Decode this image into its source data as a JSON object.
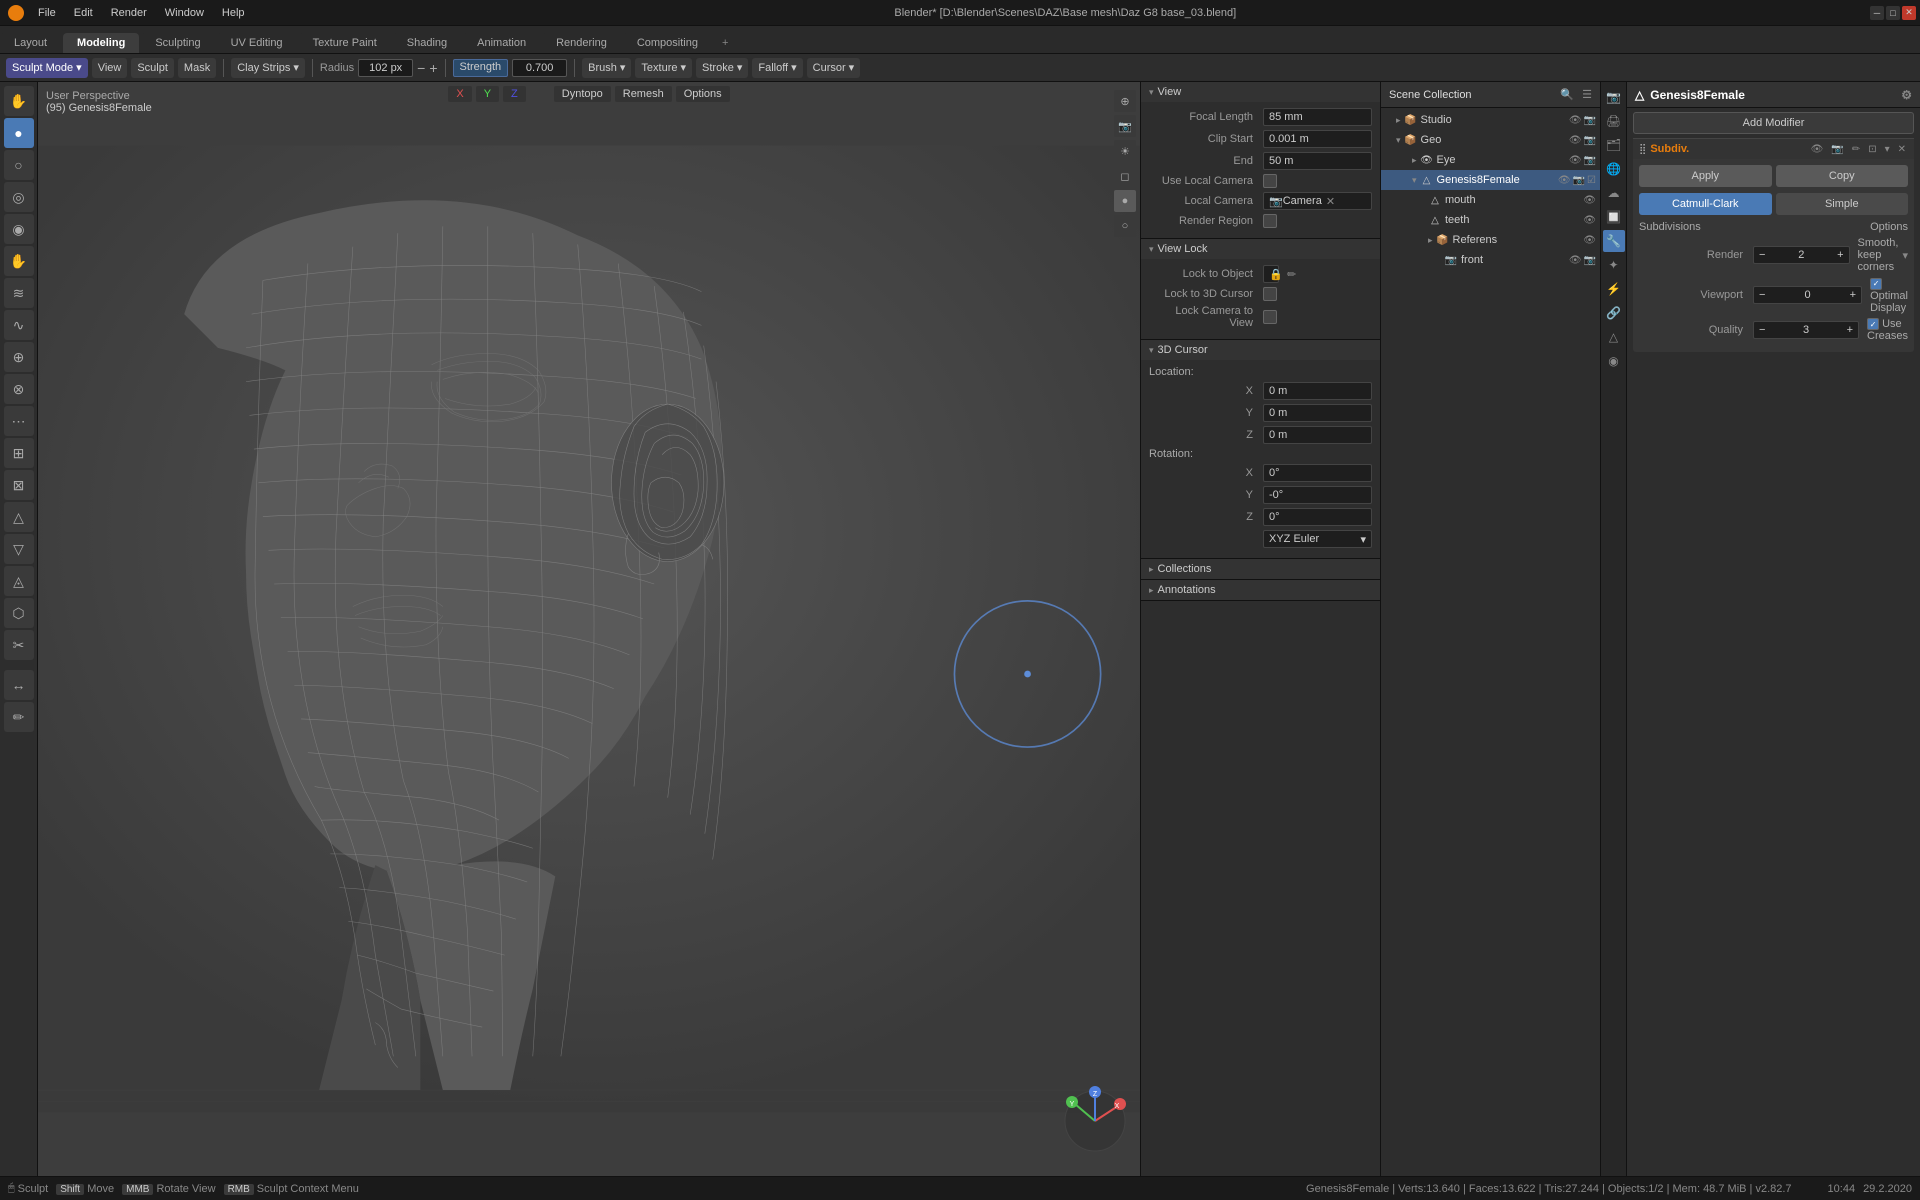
{
  "title_bar": {
    "title": "Blender* [D:\\Blender\\Scenes\\DAZ\\Base mesh\\Daz G8 base_03.blend]",
    "logo_color": "#e87d0d"
  },
  "menu": {
    "items": [
      "File",
      "Edit",
      "Render",
      "Window",
      "Help"
    ],
    "workspace_tabs": [
      "Layout",
      "Modeling",
      "Sculpting",
      "UV Editing",
      "Texture Paint",
      "Shading",
      "Animation",
      "Rendering",
      "Compositing"
    ],
    "active_tab": "Modeling"
  },
  "toolbar": {
    "mode_label": "Sculpt Mode",
    "view_label": "View",
    "sculpt_label": "Sculpt",
    "mask_label": "Mask",
    "brush_name": "Clay Strips",
    "radius_label": "Radius",
    "radius_value": "102 px",
    "strength_label": "Strength",
    "strength_value": "0.700",
    "brush_label": "Brush",
    "texture_label": "Texture",
    "stroke_label": "Stroke",
    "falloff_label": "Falloff",
    "cursor_label": "Cursor"
  },
  "viewport": {
    "view_label": "User Perspective",
    "object_name": "(95) Genesis8Female",
    "dyntopo_label": "Dyntopo",
    "remesh_label": "Remesh",
    "options_label": "Options"
  },
  "view_panel": {
    "title": "View",
    "focal_length_label": "Focal Length",
    "focal_length_value": "85 mm",
    "clip_start_label": "Clip Start",
    "clip_start_value": "0.001 m",
    "end_label": "End",
    "end_value": "50 m",
    "use_local_camera_label": "Use Local Camera",
    "local_camera_label": "Local Camera",
    "camera_label": "Camera",
    "render_region_label": "Render Region"
  },
  "view_lock_panel": {
    "title": "View Lock",
    "lock_to_object_label": "Lock to Object",
    "lock_to_3d_cursor_label": "Lock to 3D Cursor",
    "lock_camera_to_view_label": "Lock Camera to View"
  },
  "cursor_panel": {
    "title": "3D Cursor",
    "location_label": "Location:",
    "x_label": "X",
    "x_value": "0 m",
    "y_label": "Y",
    "y_value": "0 m",
    "z_label": "Z",
    "z_value": "0 m",
    "rotation_label": "Rotation:",
    "rx_value": "0°",
    "ry_value": "-0°",
    "rz_value": "0°",
    "xyz_euler_label": "XYZ Euler"
  },
  "collections_panel": {
    "title": "Collections"
  },
  "annotations_panel": {
    "title": "Annotations"
  },
  "outliner": {
    "title": "Scene Collection",
    "items": [
      {
        "name": "Studio",
        "level": 1,
        "icon": "📦",
        "active": false
      },
      {
        "name": "Geo",
        "level": 1,
        "icon": "📦",
        "active": false
      },
      {
        "name": "Eye",
        "level": 2,
        "icon": "👁",
        "active": false
      },
      {
        "name": "Genesis8Female",
        "level": 2,
        "icon": "△",
        "active": true
      },
      {
        "name": "mouth",
        "level": 3,
        "icon": "△",
        "active": false
      },
      {
        "name": "teeth",
        "level": 3,
        "icon": "△",
        "active": false
      },
      {
        "name": "Referens",
        "level": 3,
        "icon": "📦",
        "active": false
      },
      {
        "name": "front",
        "level": 3,
        "icon": "📷",
        "active": false
      }
    ]
  },
  "properties": {
    "object_name": "Genesis8Female",
    "add_modifier_label": "Add Modifier",
    "modifier": {
      "name": "Subdiv.",
      "apply_label": "Apply",
      "copy_label": "Copy",
      "catmull_clark_label": "Catmull-Clark",
      "simple_label": "Simple",
      "subdivisions_label": "Subdivisions",
      "render_label": "Render",
      "render_value": "2",
      "viewport_label": "Viewport",
      "viewport_value": "0",
      "quality_label": "Quality",
      "quality_value": "3",
      "options_label": "Options",
      "smooth_keep_corners_label": "Smooth, keep corners",
      "optimal_display_label": "Optimal Display",
      "use_creases_label": "Use Creases"
    }
  },
  "status_bar": {
    "sculpt_label": "Sculpt",
    "move_label": "Move",
    "rotate_view_label": "Rotate View",
    "sculpt_context_menu_label": "Sculpt Context Menu",
    "info": "Genesis8Female | Verts:13.640 | Faces:13.622 | Tris:27.244 | Objects:1/2 | Mem: 48.7 MiB | v2.82.7",
    "time": "10:44",
    "date": "29.2.2020"
  },
  "axes": {
    "x": "X",
    "y": "Y",
    "z": "Z"
  },
  "icons": {
    "arrow_down": "▾",
    "arrow_right": "▸",
    "check": "✓",
    "triangle": "△",
    "circle": "○",
    "dot": "●",
    "close": "✕",
    "camera": "📷",
    "eye": "👁",
    "box": "📦",
    "lock": "🔒",
    "cursor_icon": "✛",
    "search": "🔍"
  },
  "prop_icons": [
    {
      "icon": "📷",
      "name": "render-props-icon"
    },
    {
      "icon": "🎬",
      "name": "output-props-icon"
    },
    {
      "icon": "🌍",
      "name": "scene-props-icon"
    },
    {
      "icon": "⚙",
      "name": "world-props-icon"
    },
    {
      "icon": "👤",
      "name": "object-props-icon"
    },
    {
      "icon": "✦",
      "name": "modifier-props-icon"
    },
    {
      "icon": "▲",
      "name": "particles-props-icon"
    },
    {
      "icon": "🔧",
      "name": "physics-props-icon"
    },
    {
      "icon": "🎨",
      "name": "material-props-icon"
    },
    {
      "icon": "🖼",
      "name": "texture-props-icon"
    }
  ],
  "tool_icons": [
    "✋",
    "↔",
    "↕",
    "↺",
    "○",
    "●",
    "◎",
    "◉",
    "≋",
    "∿",
    "⊕",
    "⊗",
    "⋯",
    "⊞",
    "⊠",
    "△",
    "▽",
    "◬",
    "⬡",
    "✂"
  ]
}
